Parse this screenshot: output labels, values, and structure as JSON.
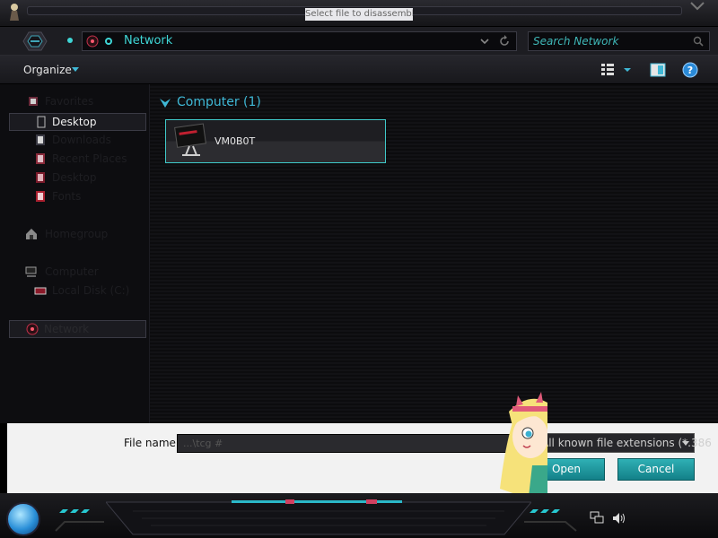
{
  "window": {
    "title": "Select file to disassemble"
  },
  "address": {
    "location": "Network",
    "search_placeholder": "Search Network"
  },
  "toolbar": {
    "organize_label": "Organize"
  },
  "navigation": {
    "items": [
      {
        "icon": "star-icon",
        "label": "Favorites",
        "selected": false
      },
      {
        "icon": "desktop-icon",
        "label": "Desktop",
        "selected": true
      },
      {
        "icon": "downloads-icon",
        "label": "Downloads",
        "selected": false
      },
      {
        "icon": "recent-places-icon",
        "label": "Recent Places",
        "selected": false
      },
      {
        "icon": "folder-icon",
        "label": "Desktop",
        "selected": false
      },
      {
        "icon": "folder-icon",
        "label": "Fonts",
        "selected": false
      },
      {
        "icon": "homegroup-icon",
        "label": "Homegroup",
        "selected": false
      },
      {
        "icon": "computer-icon",
        "label": "Computer",
        "selected": false
      },
      {
        "icon": "drive-icon",
        "label": "Local Disk (C:)",
        "selected": false
      },
      {
        "icon": "network-icon",
        "label": "Network",
        "selected": true
      }
    ]
  },
  "content": {
    "group_label": "Computer (1)",
    "computer_name": "VM0B0T"
  },
  "bottom": {
    "filename_label": "File name:",
    "filename_value": "...\\tcg #",
    "filetype_value": "All known file extensions (*.386",
    "open_label": "Open",
    "cancel_label": "Cancel"
  },
  "colors": {
    "accent": "#3fd6d6",
    "button": "#1f9aa0",
    "background": "#0c0c0e"
  }
}
